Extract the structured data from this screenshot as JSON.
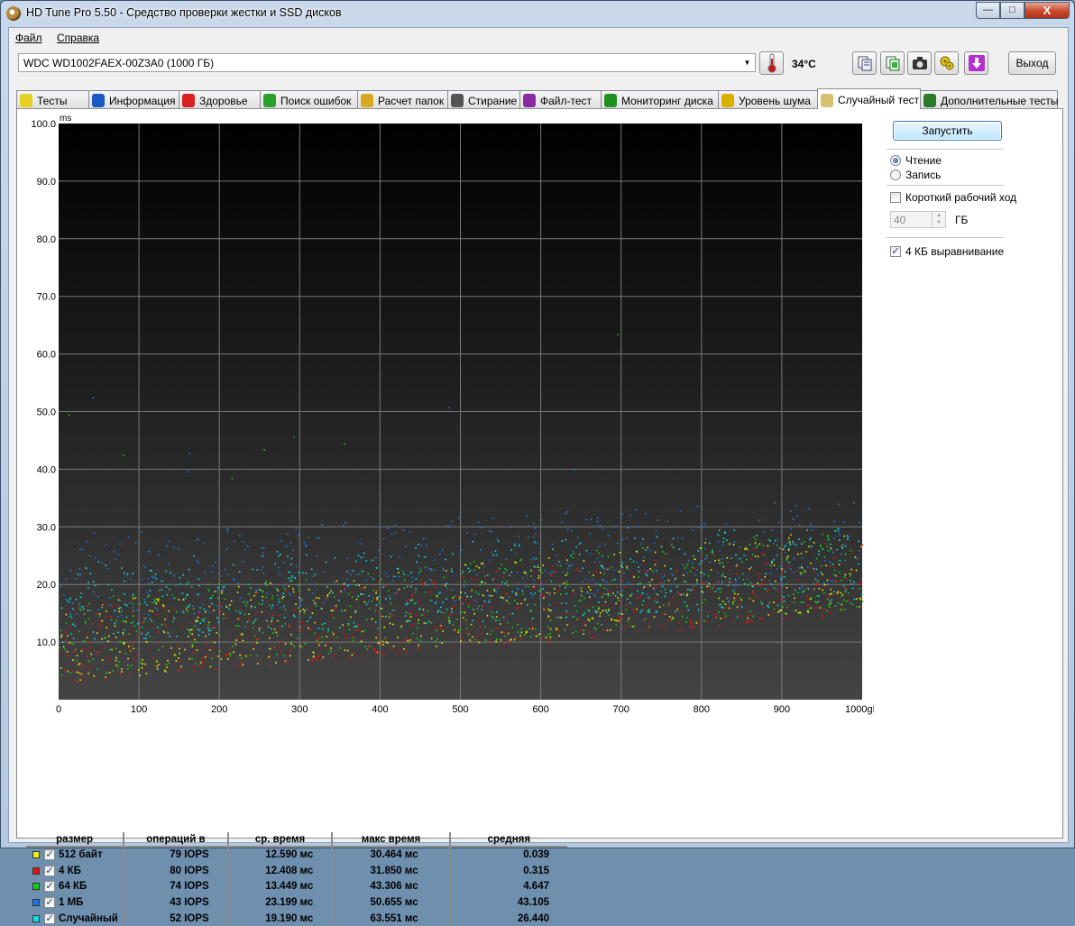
{
  "window": {
    "title": "HD Tune Pro 5.50 - Средство проверки жестки и SSD дисков",
    "close_glyph": "X",
    "min_glyph": "—",
    "max_glyph": "□"
  },
  "menu": {
    "file": "Файл",
    "help": "Справка"
  },
  "toolbar": {
    "drive": "WDC WD1002FAEX-00Z3A0 (1000 ГБ)",
    "temperature": "34°C",
    "exit_label": "Выход",
    "icons": [
      "thermometer-icon",
      "copy-info-icon",
      "copy-screen-icon",
      "camera-icon",
      "options-icon",
      "save-arrow-icon"
    ]
  },
  "tabs": [
    {
      "label": "Тесты",
      "icon": "bulb-icon"
    },
    {
      "label": "Информация",
      "icon": "info-icon"
    },
    {
      "label": "Здоровье",
      "icon": "health-cross-icon"
    },
    {
      "label": "Поиск ошибок",
      "icon": "magnifier-icon"
    },
    {
      "label": "Расчет папок",
      "icon": "folder-icon"
    },
    {
      "label": "Стирание",
      "icon": "trash-icon"
    },
    {
      "label": "Файл-тест",
      "icon": "file-test-icon"
    },
    {
      "label": "Мониторинг диска",
      "icon": "monitor-icon"
    },
    {
      "label": "Уровень шума",
      "icon": "speaker-icon"
    },
    {
      "label": "Случайный тест",
      "icon": "random-icon",
      "active": true
    },
    {
      "label": "Дополнительные тесты",
      "icon": "extra-tests-icon"
    }
  ],
  "side_panel": {
    "run_label": "Запустить",
    "read_label": "Чтение",
    "write_label": "Запись",
    "short_stroke_label": "Короткий рабочий ход",
    "short_stroke_value": "40",
    "short_stroke_unit": "ГБ",
    "align_label": "4 КБ выравнивание",
    "read_selected": true,
    "short_stroke_checked": false,
    "align_checked": true
  },
  "results": {
    "headers": [
      "размер",
      "операций в",
      "ср. время",
      "макс время",
      "средняя"
    ],
    "rows": [
      {
        "label": "512 байт",
        "color": "#f0f000",
        "iops": "79 IOPS",
        "avg": "12.590 мс",
        "max": "30.464 мс",
        "mean": "0.039"
      },
      {
        "label": "4 КБ",
        "color": "#e81010",
        "iops": "80 IOPS",
        "avg": "12.408 мс",
        "max": "31.850 мс",
        "mean": "0.315"
      },
      {
        "label": "64 КБ",
        "color": "#10d010",
        "iops": "74 IOPS",
        "avg": "13.449 мс",
        "max": "43.306 мс",
        "mean": "4.647"
      },
      {
        "label": "1 МБ",
        "color": "#1878e8",
        "iops": "43 IOPS",
        "avg": "23.199 мс",
        "max": "50.655 мс",
        "mean": "43.105"
      },
      {
        "label": "Случайный",
        "color": "#10e0e0",
        "iops": "52 IOPS",
        "avg": "19.190 мс",
        "max": "63.551 мс",
        "mean": "26.440"
      }
    ]
  },
  "chart_data": {
    "type": "scatter",
    "ylabel": "ms",
    "xlabel": "gB",
    "xlim": [
      0,
      1000
    ],
    "ylim": [
      0,
      100
    ],
    "x_ticks": [
      "0",
      "100",
      "200",
      "300",
      "400",
      "500",
      "600",
      "700",
      "800",
      "900",
      "1000gB"
    ],
    "y_ticks": [
      "10.0",
      "20.0",
      "30.0",
      "40.0",
      "50.0",
      "60.0",
      "70.0",
      "80.0",
      "90.0",
      "100.0"
    ],
    "grid": true,
    "series": [
      {
        "name": "512 байт",
        "color": "#f0f000",
        "min_ms_start": 3,
        "min_ms_end": 16,
        "spread_ms": 14
      },
      {
        "name": "4 КБ",
        "color": "#e81010",
        "min_ms_start": 3,
        "min_ms_end": 15,
        "spread_ms": 13
      },
      {
        "name": "64 КБ",
        "color": "#10d010",
        "min_ms_start": 4,
        "min_ms_end": 16,
        "spread_ms": 14
      },
      {
        "name": "1 МБ",
        "color": "#1878e8",
        "min_ms_start": 14,
        "min_ms_end": 20,
        "spread_ms": 15
      },
      {
        "name": "Случайный",
        "color": "#10e0e0",
        "min_ms_start": 10,
        "min_ms_end": 17,
        "spread_ms": 14
      }
    ],
    "outliers": [
      [
        12,
        49.5
      ],
      [
        42,
        52.5
      ],
      [
        80,
        42.5
      ],
      [
        162,
        42.8
      ],
      [
        255,
        43.5
      ],
      [
        292,
        45.7
      ],
      [
        355,
        44.5
      ],
      [
        485,
        50.8
      ],
      [
        695,
        63.5
      ],
      [
        160,
        39.7
      ],
      [
        215,
        38.5
      ],
      [
        640,
        40.0
      ]
    ]
  }
}
